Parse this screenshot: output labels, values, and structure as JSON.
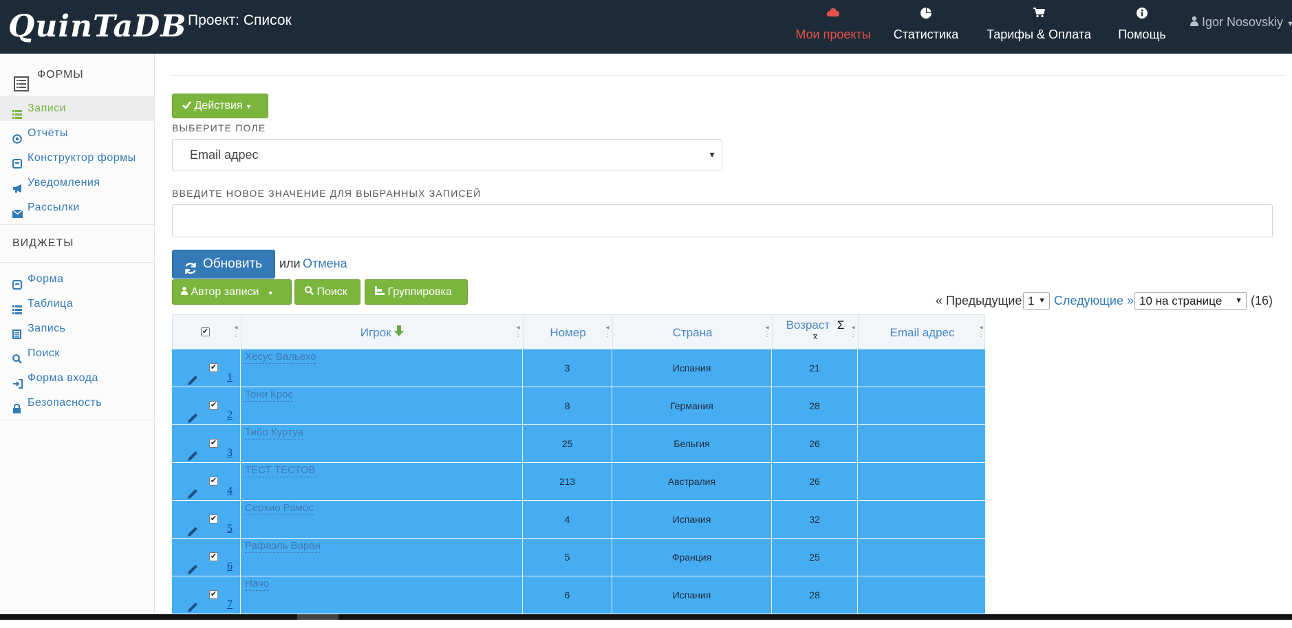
{
  "navbar": {
    "brand": "QuinTaDB",
    "project_title": "Проект: Список",
    "items": [
      {
        "label": "Мои проекты",
        "icon": "cloud-icon",
        "active": true
      },
      {
        "label": "Статистика",
        "icon": "pie-chart-icon"
      },
      {
        "label": "Тарифы & Оплата",
        "icon": "cart-icon"
      },
      {
        "label": "Помощь",
        "icon": "info-icon"
      }
    ],
    "user": "Igor Nosovskiy"
  },
  "sidebar": {
    "forms_title": "ФОРМЫ",
    "forms_items": [
      {
        "label": "Записи",
        "icon": "list-icon",
        "active": true
      },
      {
        "label": "Отчёты",
        "icon": "target-icon"
      },
      {
        "label": "Конструктор формы",
        "icon": "form-icon"
      },
      {
        "label": "Уведомления",
        "icon": "bullhorn-icon"
      },
      {
        "label": "Рассылки",
        "icon": "envelope-icon"
      }
    ],
    "widgets_title": "ВИДЖЕТЫ",
    "widget_items": [
      {
        "label": "Форма",
        "icon": "form-icon"
      },
      {
        "label": "Таблица",
        "icon": "list-icon"
      },
      {
        "label": "Запись",
        "icon": "record-icon"
      },
      {
        "label": "Поиск",
        "icon": "search-icon"
      },
      {
        "label": "Форма входа",
        "icon": "login-icon"
      },
      {
        "label": "Безопасность",
        "icon": "lock-icon"
      }
    ]
  },
  "actions": {
    "actions_button": "Действия",
    "select_field_label": "ВЫБЕРИТЕ ПОЛЕ",
    "select_field_value": "Email адрес",
    "new_value_label": "ВВЕДИТЕ НОВОЕ ЗНАЧЕНИЕ ДЛЯ ВЫБРАННЫХ ЗАПИСЕЙ",
    "new_value": "",
    "update_button": "Обновить",
    "or_text": "или",
    "cancel_link": "Отмена"
  },
  "toolbar": {
    "author_button": "Автор записи",
    "search_button": "Поиск",
    "group_button": "Группировка"
  },
  "pager": {
    "prev": "« Предыдущие",
    "page": "1",
    "next": "Следующие »",
    "per_page": "10 на странице",
    "total": "(16)"
  },
  "table": {
    "columns": [
      "Игрок",
      "Номер",
      "Страна",
      "Возраст",
      "Email адрес"
    ],
    "sum_symbol": "Σ",
    "rows": [
      {
        "id": "1",
        "player": "Хесус Вальехо",
        "number": "3",
        "country": "Испания",
        "age": "21",
        "email": ""
      },
      {
        "id": "2",
        "player": "Тони Крос",
        "number": "8",
        "country": "Германия",
        "age": "28",
        "email": ""
      },
      {
        "id": "3",
        "player": "Тибо Куртуа",
        "number": "25",
        "country": "Бельгия",
        "age": "26",
        "email": ""
      },
      {
        "id": "4",
        "player": "ТЕСТ ТЕСТОВ",
        "number": "213",
        "country": "Австралия",
        "age": "26",
        "email": ""
      },
      {
        "id": "5",
        "player": "Серхио Рамос",
        "number": "4",
        "country": "Испания",
        "age": "32",
        "email": ""
      },
      {
        "id": "6",
        "player": "Рафаэль Варан",
        "number": "5",
        "country": "Франция",
        "age": "25",
        "email": ""
      },
      {
        "id": "7",
        "player": "Начо",
        "number": "6",
        "country": "Испания",
        "age": "28",
        "email": ""
      }
    ]
  }
}
